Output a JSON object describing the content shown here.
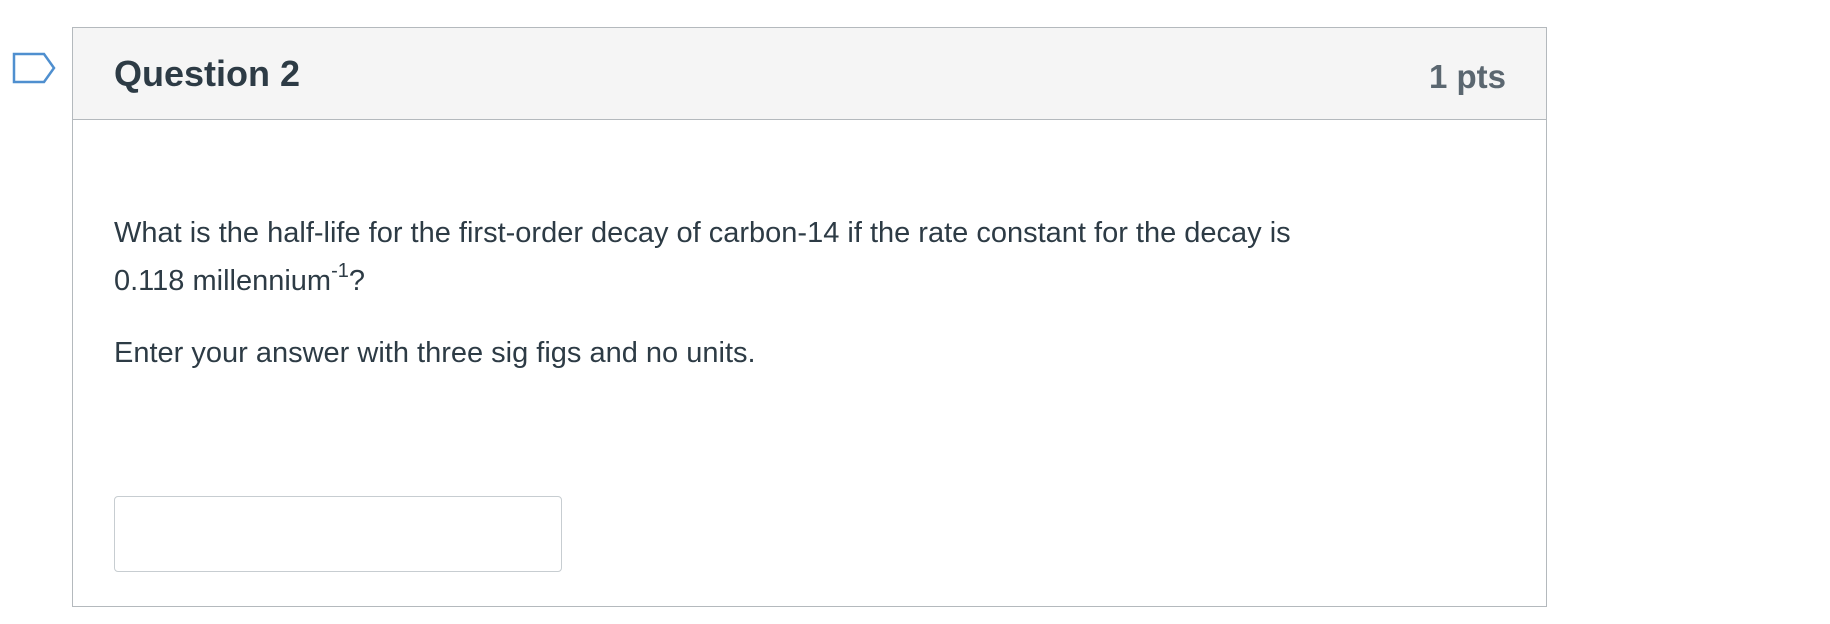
{
  "question": {
    "name": "Question 2",
    "points": "1 pts",
    "text_line1": "What is the half-life for the first-order decay of carbon-14 if the rate constant for the decay is",
    "text_line2_value": "0.118  millennium",
    "text_line2_exponent": "-1",
    "text_line2_end": "?",
    "instruction": "Enter your answer with three sig figs and no units.",
    "answer": {
      "value": "",
      "placeholder": ""
    }
  },
  "icons": {
    "flag": "bookmark-flag-icon"
  },
  "colors": {
    "flag": "#4f8fcf",
    "header_bg": "#f5f5f5",
    "border": "#b4b9bd",
    "text": "#2d3b45",
    "points_text": "#5b6770"
  }
}
